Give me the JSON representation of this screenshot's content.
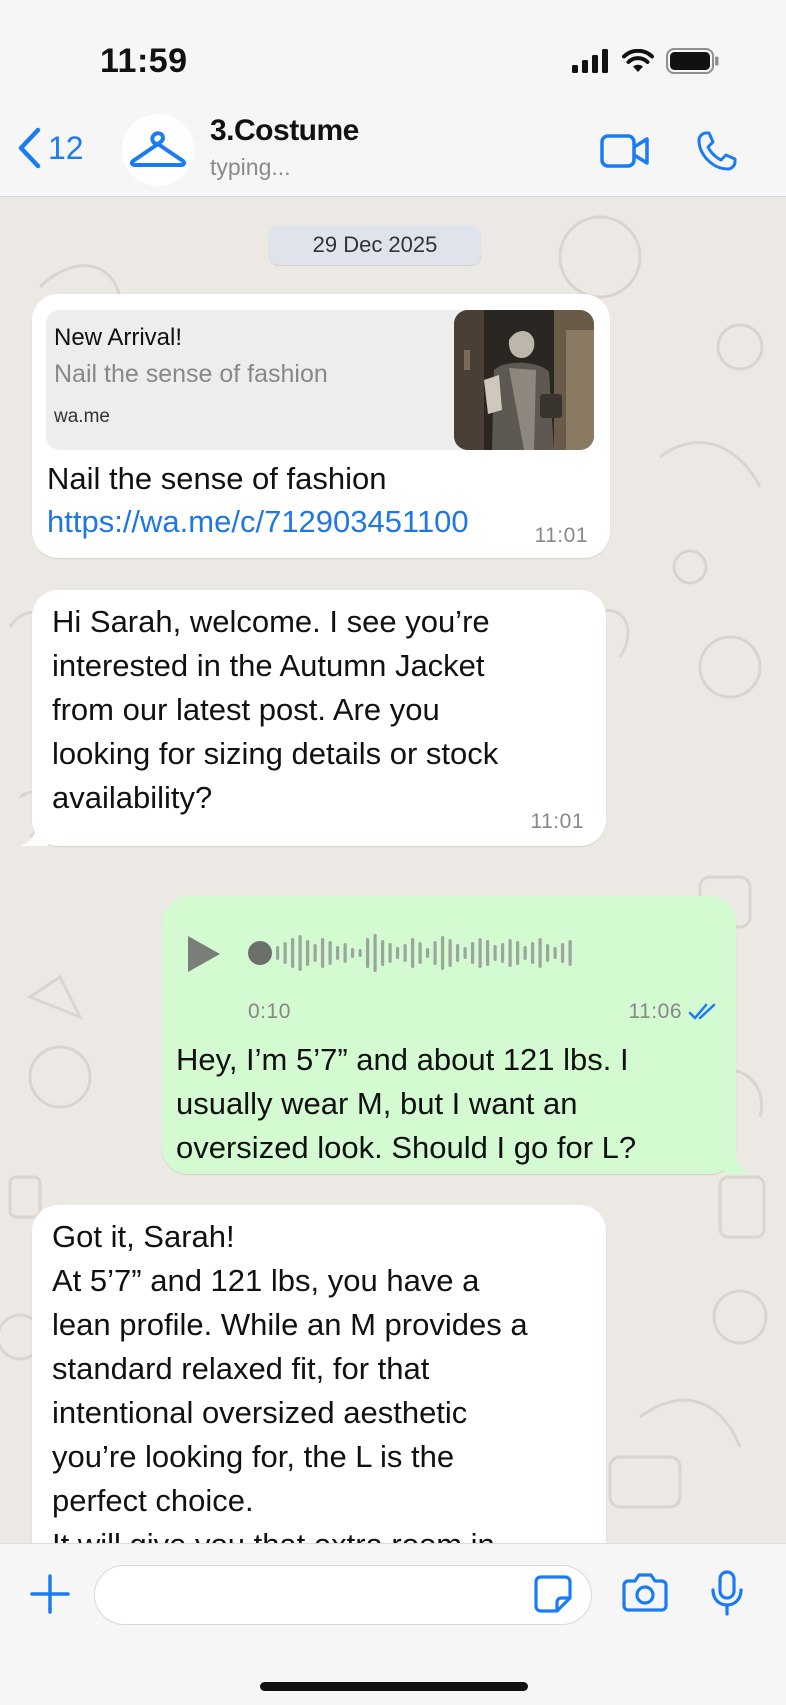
{
  "status_bar": {
    "time": "11:59"
  },
  "header": {
    "back_count": "12",
    "chat_name": "3.Costume",
    "chat_status": "typing..."
  },
  "chat": {
    "date_chip": "29 Dec 2025",
    "messages": [
      {
        "preview_title": "New Arrival!",
        "preview_desc": "Nail the sense of fashion",
        "preview_domain": "wa.me",
        "text": "Nail the sense of fashion",
        "link": "https://wa.me/c/712903451100",
        "time": "11:01"
      },
      {
        "lines": [
          "Hi Sarah, welcome. I see you’re",
          "interested in the Autumn Jacket",
          "from our latest post. Are you",
          "looking for sizing details or stock",
          "availability?"
        ],
        "time": "11:01"
      },
      {
        "voice_duration": "0:10",
        "voice_progress": 0.0,
        "time": "11:06",
        "read_status": "read",
        "lines": [
          "Hey, I’m 5’7” and about 121 lbs. I",
          "usually wear M, but I want an",
          "oversized look. Should I go for L?"
        ]
      },
      {
        "lines": [
          "Got it, Sarah!",
          "At 5’7” and 121 lbs, you have a",
          "lean profile. While an M provides a",
          "standard relaxed fit, for that",
          "intentional oversized aesthetic",
          "you’re looking for, the L is the",
          "perfect choice.",
          "It will give you that extra room in"
        ]
      }
    ]
  },
  "input_bar": {
    "placeholder": ""
  },
  "colors": {
    "accent": "#1a7cf2",
    "outgoing_bubble": "#d3fad1",
    "incoming_bubble": "#ffffff",
    "chat_background": "#ece8e3",
    "date_chip": "#dfe3ec"
  },
  "icons": [
    "back-chevron-icon",
    "hanger-icon",
    "video-camera-icon",
    "phone-icon",
    "play-icon",
    "double-check-icon",
    "plus-icon",
    "sticker-icon",
    "camera-icon",
    "microphone-icon",
    "signal-icon",
    "wifi-icon",
    "battery-icon"
  ]
}
